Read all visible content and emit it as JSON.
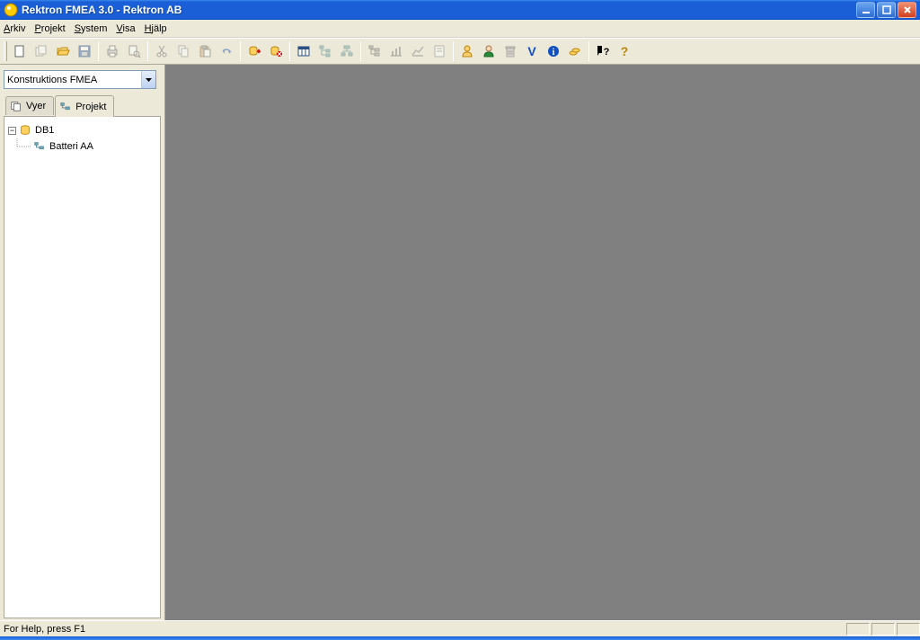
{
  "title": "Rektron FMEA 3.0 - Rektron AB",
  "menu": {
    "arkiv": "Arkiv",
    "projekt": "Projekt",
    "system": "System",
    "visa": "Visa",
    "hjalp": "Hjälp"
  },
  "dropdown": {
    "selected": "Konstruktions FMEA"
  },
  "tabs": {
    "vyer": "Vyer",
    "projekt": "Projekt"
  },
  "tree": {
    "root": "DB1",
    "child1": "Batteri AA"
  },
  "status": {
    "help": "For Help, press F1"
  },
  "toolbar_icons": [
    "new-document",
    "copy-window",
    "open-folder",
    "save",
    "print",
    "print-preview",
    "cut",
    "copy",
    "paste",
    "undo",
    "db-refresh",
    "db-commit",
    "view-table",
    "view-tree1",
    "view-tree2",
    "report1",
    "chart",
    "chart2",
    "note",
    "user-yellow",
    "user-green",
    "trash",
    "v-letter",
    "info",
    "coins",
    "context-help",
    "help"
  ]
}
